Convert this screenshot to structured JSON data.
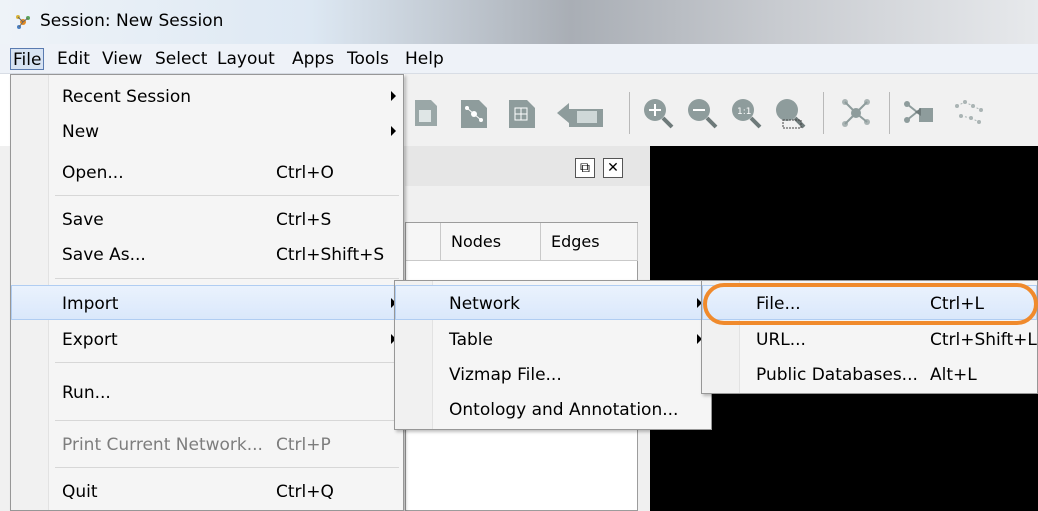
{
  "window": {
    "title": "Session: New Session"
  },
  "menubar": {
    "items": [
      {
        "label": "File"
      },
      {
        "label": "Edit"
      },
      {
        "label": "View"
      },
      {
        "label": "Select"
      },
      {
        "label": "Layout"
      },
      {
        "label": "Apps"
      },
      {
        "label": "Tools"
      },
      {
        "label": "Help"
      }
    ]
  },
  "table": {
    "columns": [
      "Nodes",
      "Edges"
    ]
  },
  "file_menu": {
    "items": [
      {
        "label": "Recent Session",
        "submenu": true
      },
      {
        "label": "New",
        "submenu": true
      },
      {
        "label": "Open...",
        "shortcut": "Ctrl+O"
      },
      {
        "label": "Save",
        "shortcut": "Ctrl+S"
      },
      {
        "label": "Save As...",
        "shortcut": "Ctrl+Shift+S"
      },
      {
        "label": "Import",
        "submenu": true,
        "highlighted": true
      },
      {
        "label": "Export",
        "submenu": true
      },
      {
        "label": "Run..."
      },
      {
        "label": "Print Current Network...",
        "shortcut": "Ctrl+P",
        "disabled": true
      },
      {
        "label": "Quit",
        "shortcut": "Ctrl+Q"
      }
    ]
  },
  "import_menu": {
    "items": [
      {
        "label": "Network",
        "submenu": true,
        "highlighted": true
      },
      {
        "label": "Table",
        "submenu": true
      },
      {
        "label": "Vizmap File..."
      },
      {
        "label": "Ontology and Annotation..."
      }
    ]
  },
  "network_menu": {
    "items": [
      {
        "label": "File...",
        "shortcut": "Ctrl+L",
        "highlighted": true
      },
      {
        "label": "URL...",
        "shortcut": "Ctrl+Shift+L"
      },
      {
        "label": "Public Databases...",
        "shortcut": "Alt+L"
      }
    ]
  },
  "colors": {
    "highlight_ring": "#f08a2c",
    "network_bg": "#000000"
  }
}
